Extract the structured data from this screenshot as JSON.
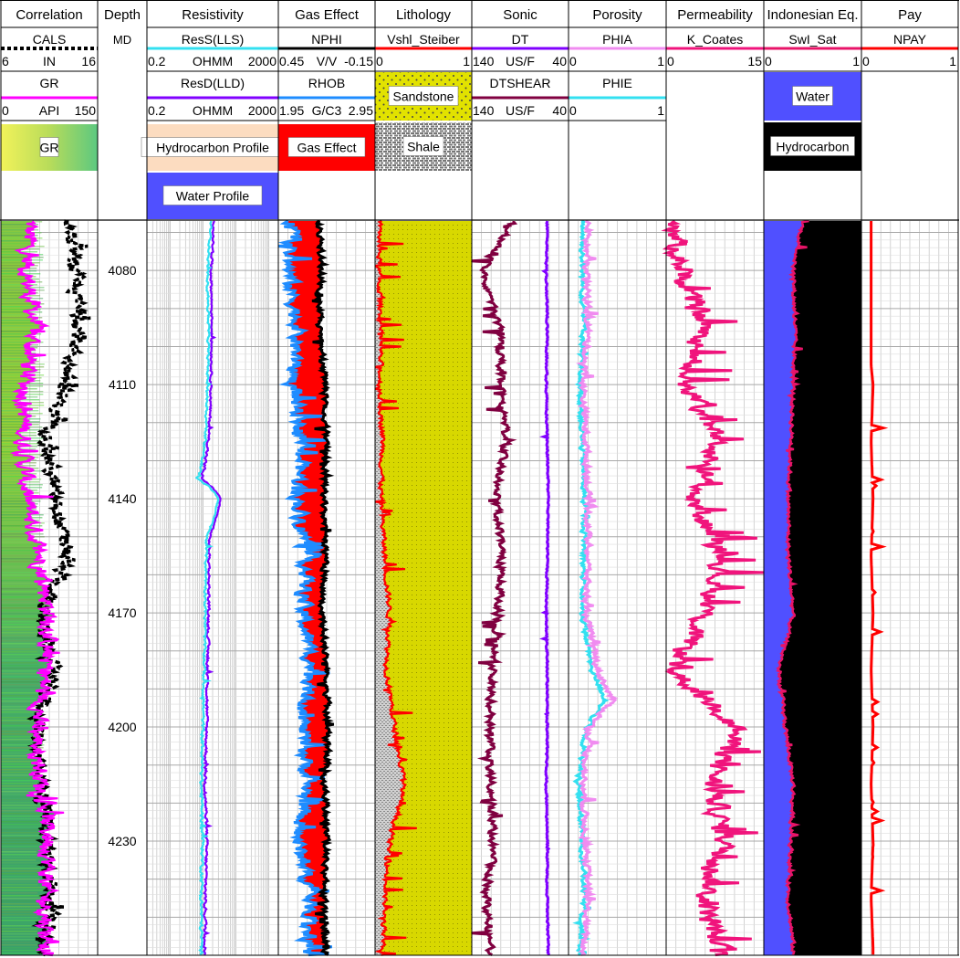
{
  "chart_data": {
    "type": "line",
    "title": "",
    "depth": {
      "title": "Depth",
      "unit": "MD",
      "range": [
        4067,
        4260
      ],
      "ticks": [
        4080,
        4110,
        4140,
        4170,
        4200,
        4230
      ]
    },
    "tracks": [
      {
        "title": "Correlation",
        "curves": [
          {
            "name": "CALS",
            "unit": "IN",
            "min": 6,
            "max": 16,
            "color": "#000000",
            "style": "dotted"
          },
          {
            "name": "GR",
            "unit": "API",
            "min": 0,
            "max": 150,
            "color": "#ff00ff",
            "style": "solid"
          }
        ],
        "legend": [
          {
            "label": "GR",
            "fill": "gradient-yellow-green"
          }
        ],
        "series": {
          "CALS": {
            "depth": [
              4067,
              4080,
              4095,
              4110,
              4125,
              4140,
              4155,
              4170,
              4185,
              4200,
              4215,
              4230,
              4245,
              4258
            ],
            "values": [
              13,
              13.5,
              14.2,
              12.5,
              10.8,
              11.5,
              12.8,
              10.2,
              11.2,
              9.8,
              10.2,
              10.8,
              11.3,
              10.2
            ]
          },
          "GR": {
            "depth": [
              4067,
              4080,
              4095,
              4110,
              4125,
              4140,
              4155,
              4170,
              4185,
              4200,
              4215,
              4230,
              4245,
              4258
            ],
            "values": [
              45,
              40,
              52,
              38,
              35,
              40,
              60,
              75,
              70,
              55,
              62,
              75,
              68,
              72
            ]
          }
        }
      },
      {
        "title": "Resistivity",
        "curves": [
          {
            "name": "ResS(LLS)",
            "unit": "OHMM",
            "min": 0.2,
            "max": 2000,
            "color": "#33e0f0",
            "style": "solid",
            "log": true
          },
          {
            "name": "ResD(LLD)",
            "unit": "OHMM",
            "min": 0.2,
            "max": 2000,
            "color": "#8000ff",
            "style": "solid",
            "log": true
          }
        ],
        "legend": [
          {
            "label": "Hydrocarbon Profile",
            "fill": "#fcdcc0"
          },
          {
            "label": "Water Profile",
            "fill": "#5050ff"
          }
        ],
        "series": {
          "ResS(LLS)": {
            "depth": [
              4067,
              4080,
              4095,
              4110,
              4125,
              4135,
              4140,
              4150,
              4170,
              4185,
              4200,
              4215,
              4230,
              4245,
              4258
            ],
            "values": [
              18,
              14,
              15,
              14,
              12,
              7,
              30,
              13,
              12,
              11,
              10,
              9,
              10,
              9,
              9
            ]
          },
          "ResD(LLD)": {
            "depth": [
              4067,
              4080,
              4095,
              4110,
              4125,
              4135,
              4140,
              4150,
              4170,
              4185,
              4200,
              4215,
              4230,
              4245,
              4258
            ],
            "values": [
              22,
              18,
              19,
              18,
              15,
              9,
              35,
              16,
              15,
              14,
              13,
              12,
              13,
              12,
              12
            ]
          }
        }
      },
      {
        "title": "Gas Effect",
        "curves": [
          {
            "name": "NPHI",
            "unit": "V/V",
            "min": 0.45,
            "max": -0.15,
            "color": "#000000",
            "style": "solid"
          },
          {
            "name": "RHOB",
            "unit": "G/C3",
            "min": 1.95,
            "max": 2.95,
            "color": "#1e8cff",
            "style": "solid"
          }
        ],
        "legend": [
          {
            "label": "Gas Effect",
            "fill": "#ff0000"
          }
        ],
        "series": {
          "NPHI": {
            "depth": [
              4067,
              4080,
              4095,
              4110,
              4125,
              4140,
              4155,
              4170,
              4185,
              4200,
              4215,
              4230,
              4245,
              4258
            ],
            "values": [
              0.2,
              0.18,
              0.2,
              0.16,
              0.15,
              0.17,
              0.16,
              0.18,
              0.15,
              0.14,
              0.16,
              0.15,
              0.17,
              0.15
            ]
          },
          "RHOB": {
            "depth": [
              4067,
              4080,
              4095,
              4110,
              4125,
              4140,
              4155,
              4170,
              4185,
              4200,
              4215,
              4230,
              4245,
              4258
            ],
            "values": [
              2.1,
              2.05,
              2.15,
              2.1,
              2.2,
              2.15,
              2.25,
              2.2,
              2.3,
              2.2,
              2.25,
              2.15,
              2.3,
              2.25
            ]
          }
        }
      },
      {
        "title": "Lithology",
        "curves": [
          {
            "name": "Vshl_Steiber",
            "unit": "",
            "min": 0,
            "max": 1,
            "color": "#ff0000",
            "style": "solid"
          }
        ],
        "legend": [
          {
            "label": "Sandstone",
            "fill": "#e0e000"
          },
          {
            "label": "Shale",
            "fill": "#808080"
          }
        ],
        "series": {
          "Vshl_Steiber": {
            "depth": [
              4067,
              4080,
              4095,
              4110,
              4125,
              4140,
              4155,
              4170,
              4185,
              4200,
              4215,
              4230,
              4245,
              4258
            ],
            "values": [
              0.05,
              0.04,
              0.06,
              0.05,
              0.08,
              0.06,
              0.1,
              0.15,
              0.12,
              0.2,
              0.3,
              0.15,
              0.1,
              0.08
            ]
          }
        }
      },
      {
        "title": "Sonic",
        "curves": [
          {
            "name": "DT",
            "unit": "US/F",
            "min": 140,
            "max": 40,
            "color": "#8000ff",
            "style": "solid"
          },
          {
            "name": "DTSHEAR",
            "unit": "US/F",
            "min": 140,
            "max": 40,
            "color": "#800040",
            "style": "solid"
          }
        ],
        "legend": [],
        "series": {
          "DT": {
            "depth": [
              4067,
              4080,
              4095,
              4110,
              4125,
              4140,
              4155,
              4170,
              4185,
              4200,
              4215,
              4230,
              4245,
              4258
            ],
            "values": [
              62,
              63,
              62,
              63,
              62,
              61,
              62,
              63,
              62,
              62,
              63,
              62,
              62,
              61
            ]
          },
          "DTSHEAR": {
            "depth": [
              4067,
              4080,
              4095,
              4110,
              4125,
              4140,
              4155,
              4170,
              4185,
              4200,
              4215,
              4230,
              4245,
              4258
            ],
            "values": [
              98,
              128,
              112,
              110,
              105,
              115,
              108,
              112,
              118,
              122,
              120,
              118,
              125,
              122
            ]
          }
        }
      },
      {
        "title": "Porosity",
        "curves": [
          {
            "name": "PHIA",
            "unit": "",
            "min": 0,
            "max": 1,
            "color": "#f08cf0",
            "style": "solid"
          },
          {
            "name": "PHIE",
            "unit": "",
            "min": 0,
            "max": 1,
            "color": "#33e0f0",
            "style": "solid"
          }
        ],
        "legend": [],
        "series": {
          "PHIA": {
            "depth": [
              4067,
              4080,
              4095,
              4110,
              4125,
              4140,
              4155,
              4170,
              4185,
              4193,
              4200,
              4215,
              4230,
              4245,
              4258
            ],
            "values": [
              0.2,
              0.18,
              0.2,
              0.15,
              0.18,
              0.2,
              0.2,
              0.18,
              0.3,
              0.45,
              0.22,
              0.15,
              0.18,
              0.2,
              0.15
            ]
          },
          "PHIE": {
            "depth": [
              4067,
              4080,
              4095,
              4110,
              4125,
              4140,
              4155,
              4170,
              4185,
              4193,
              4200,
              4215,
              4230,
              4245,
              4258
            ],
            "values": [
              0.15,
              0.14,
              0.16,
              0.12,
              0.14,
              0.16,
              0.16,
              0.14,
              0.24,
              0.38,
              0.18,
              0.1,
              0.14,
              0.16,
              0.12
            ]
          }
        }
      },
      {
        "title": "Permeability",
        "curves": [
          {
            "name": "K_Coates",
            "unit": "",
            "min": 0,
            "max": 15,
            "color": "#f0147c",
            "style": "solid"
          }
        ],
        "legend": [],
        "series": {
          "K_Coates": {
            "depth": [
              4067,
              4080,
              4095,
              4110,
              4125,
              4140,
              4155,
              4170,
              4185,
              4200,
              4215,
              4230,
              4245,
              4258
            ],
            "values": [
              1,
              2.5,
              6,
              3,
              8,
              4,
              9,
              6,
              1,
              11,
              7,
              9,
              6,
              8
            ]
          }
        }
      },
      {
        "title": "Indonesian Eq.",
        "curves": [
          {
            "name": "SwI_Sat",
            "unit": "",
            "min": 0,
            "max": 1,
            "color": "#e81468",
            "style": "solid"
          }
        ],
        "legend": [
          {
            "label": "Water",
            "fill": "#5050ff"
          },
          {
            "label": "Hydrocarbon",
            "fill": "#000000"
          }
        ],
        "series": {
          "SwI_Sat": {
            "depth": [
              4067,
              4080,
              4095,
              4110,
              4125,
              4140,
              4155,
              4170,
              4185,
              4200,
              4215,
              4230,
              4245,
              4258
            ],
            "values": [
              0.4,
              0.3,
              0.32,
              0.3,
              0.28,
              0.25,
              0.25,
              0.3,
              0.15,
              0.22,
              0.3,
              0.28,
              0.25,
              0.3
            ]
          }
        }
      },
      {
        "title": "Pay",
        "curves": [
          {
            "name": "NPAY",
            "unit": "",
            "min": 0,
            "max": 1,
            "color": "#ff0000",
            "style": "solid"
          }
        ],
        "legend": [],
        "series": {
          "NPAY": {
            "depth": [
              4067,
              4105,
              4110,
              4125,
              4140,
              4155,
              4170,
              4185,
              4200,
              4215,
              4230,
              4245,
              4258
            ],
            "values": [
              0.1,
              0.1,
              0.12,
              0.1,
              0.12,
              0.1,
              0.12,
              0.1,
              0.12,
              0.1,
              0.12,
              0.1,
              0.12
            ]
          }
        }
      }
    ],
    "scale_labels": [
      {
        "track": 0,
        "row": 0,
        "values": [
          "6",
          "IN",
          "16"
        ]
      },
      {
        "track": 0,
        "row": 1,
        "values": [
          "0",
          "API",
          "150"
        ]
      },
      {
        "track": 1,
        "row": 0,
        "values": [
          "0.2",
          "OHMM",
          "2000"
        ]
      },
      {
        "track": 1,
        "row": 1,
        "values": [
          "0.2",
          "OHMM",
          "2000"
        ]
      },
      {
        "track": 2,
        "row": 0,
        "values": [
          "0.45",
          "V/V",
          "-0.15"
        ]
      },
      {
        "track": 2,
        "row": 1,
        "values": [
          "1.95",
          "G/C3",
          "2.95"
        ]
      },
      {
        "track": 3,
        "row": 0,
        "values": [
          "0",
          "",
          "1"
        ]
      },
      {
        "track": 4,
        "row": 0,
        "values": [
          "140",
          "US/F",
          "40"
        ]
      },
      {
        "track": 4,
        "row": 1,
        "values": [
          "140",
          "US/F",
          "40"
        ]
      },
      {
        "track": 5,
        "row": 0,
        "values": [
          "0",
          "",
          "1"
        ]
      },
      {
        "track": 5,
        "row": 1,
        "values": [
          "0",
          "",
          "1"
        ]
      },
      {
        "track": 6,
        "row": 0,
        "values": [
          "0",
          "",
          "15"
        ]
      },
      {
        "track": 7,
        "row": 0,
        "values": [
          "0",
          "",
          "1"
        ]
      },
      {
        "track": 8,
        "row": 0,
        "values": [
          "0",
          "",
          "1"
        ]
      }
    ],
    "grid": true
  }
}
